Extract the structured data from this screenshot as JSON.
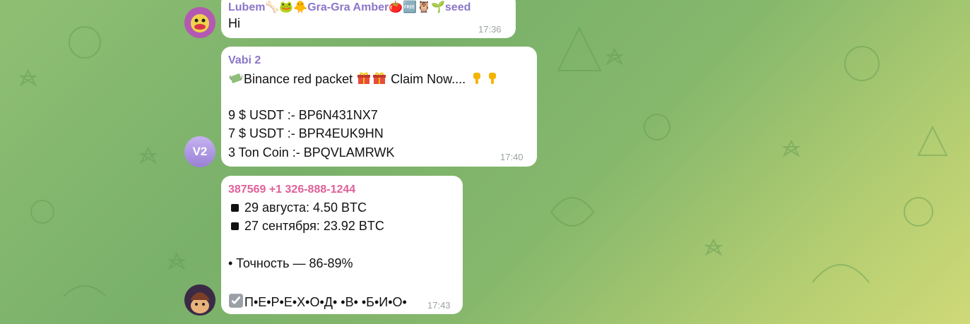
{
  "messages": [
    {
      "sender": "Lubem🦴🐸🐥Gra-Gra Amber🍅🆓🦉🌱seed",
      "sender_color": "#8a76c9",
      "lines": [
        "Hi"
      ],
      "time": "17:36"
    },
    {
      "sender": "Vabi 2",
      "sender_color": "#8a76c9",
      "avatar_text": "V2",
      "avatar_color": "#b39ddb",
      "lines": [
        "Binance red packet",
        "Claim Now....",
        "9 $ USDT :- BP6N431NX7",
        "7 $ USDT :- BPR4EUK9HN",
        "3 Ton Coin :- BPQVLAMRWK"
      ],
      "time": "17:40"
    },
    {
      "sender": "387569 +1 326-888-1244",
      "sender_color": "#e0609a",
      "lines": [
        "29 августа: 4.50 BTC",
        "27 сентября: 23.92 BTC",
        "• Точность — 86-89%",
        "П•Е•Р•Е•Х•О•Д• •В• •Б•И•О•"
      ],
      "time": "17:43"
    }
  ],
  "icons": [
    "money-wings-icon",
    "gift-icon",
    "point-down-icon",
    "black-square-icon",
    "check-box-icon",
    "bone-icon",
    "frog-icon",
    "chick-icon",
    "tomato-icon",
    "free-badge-icon",
    "owl-icon",
    "seedling-icon"
  ]
}
